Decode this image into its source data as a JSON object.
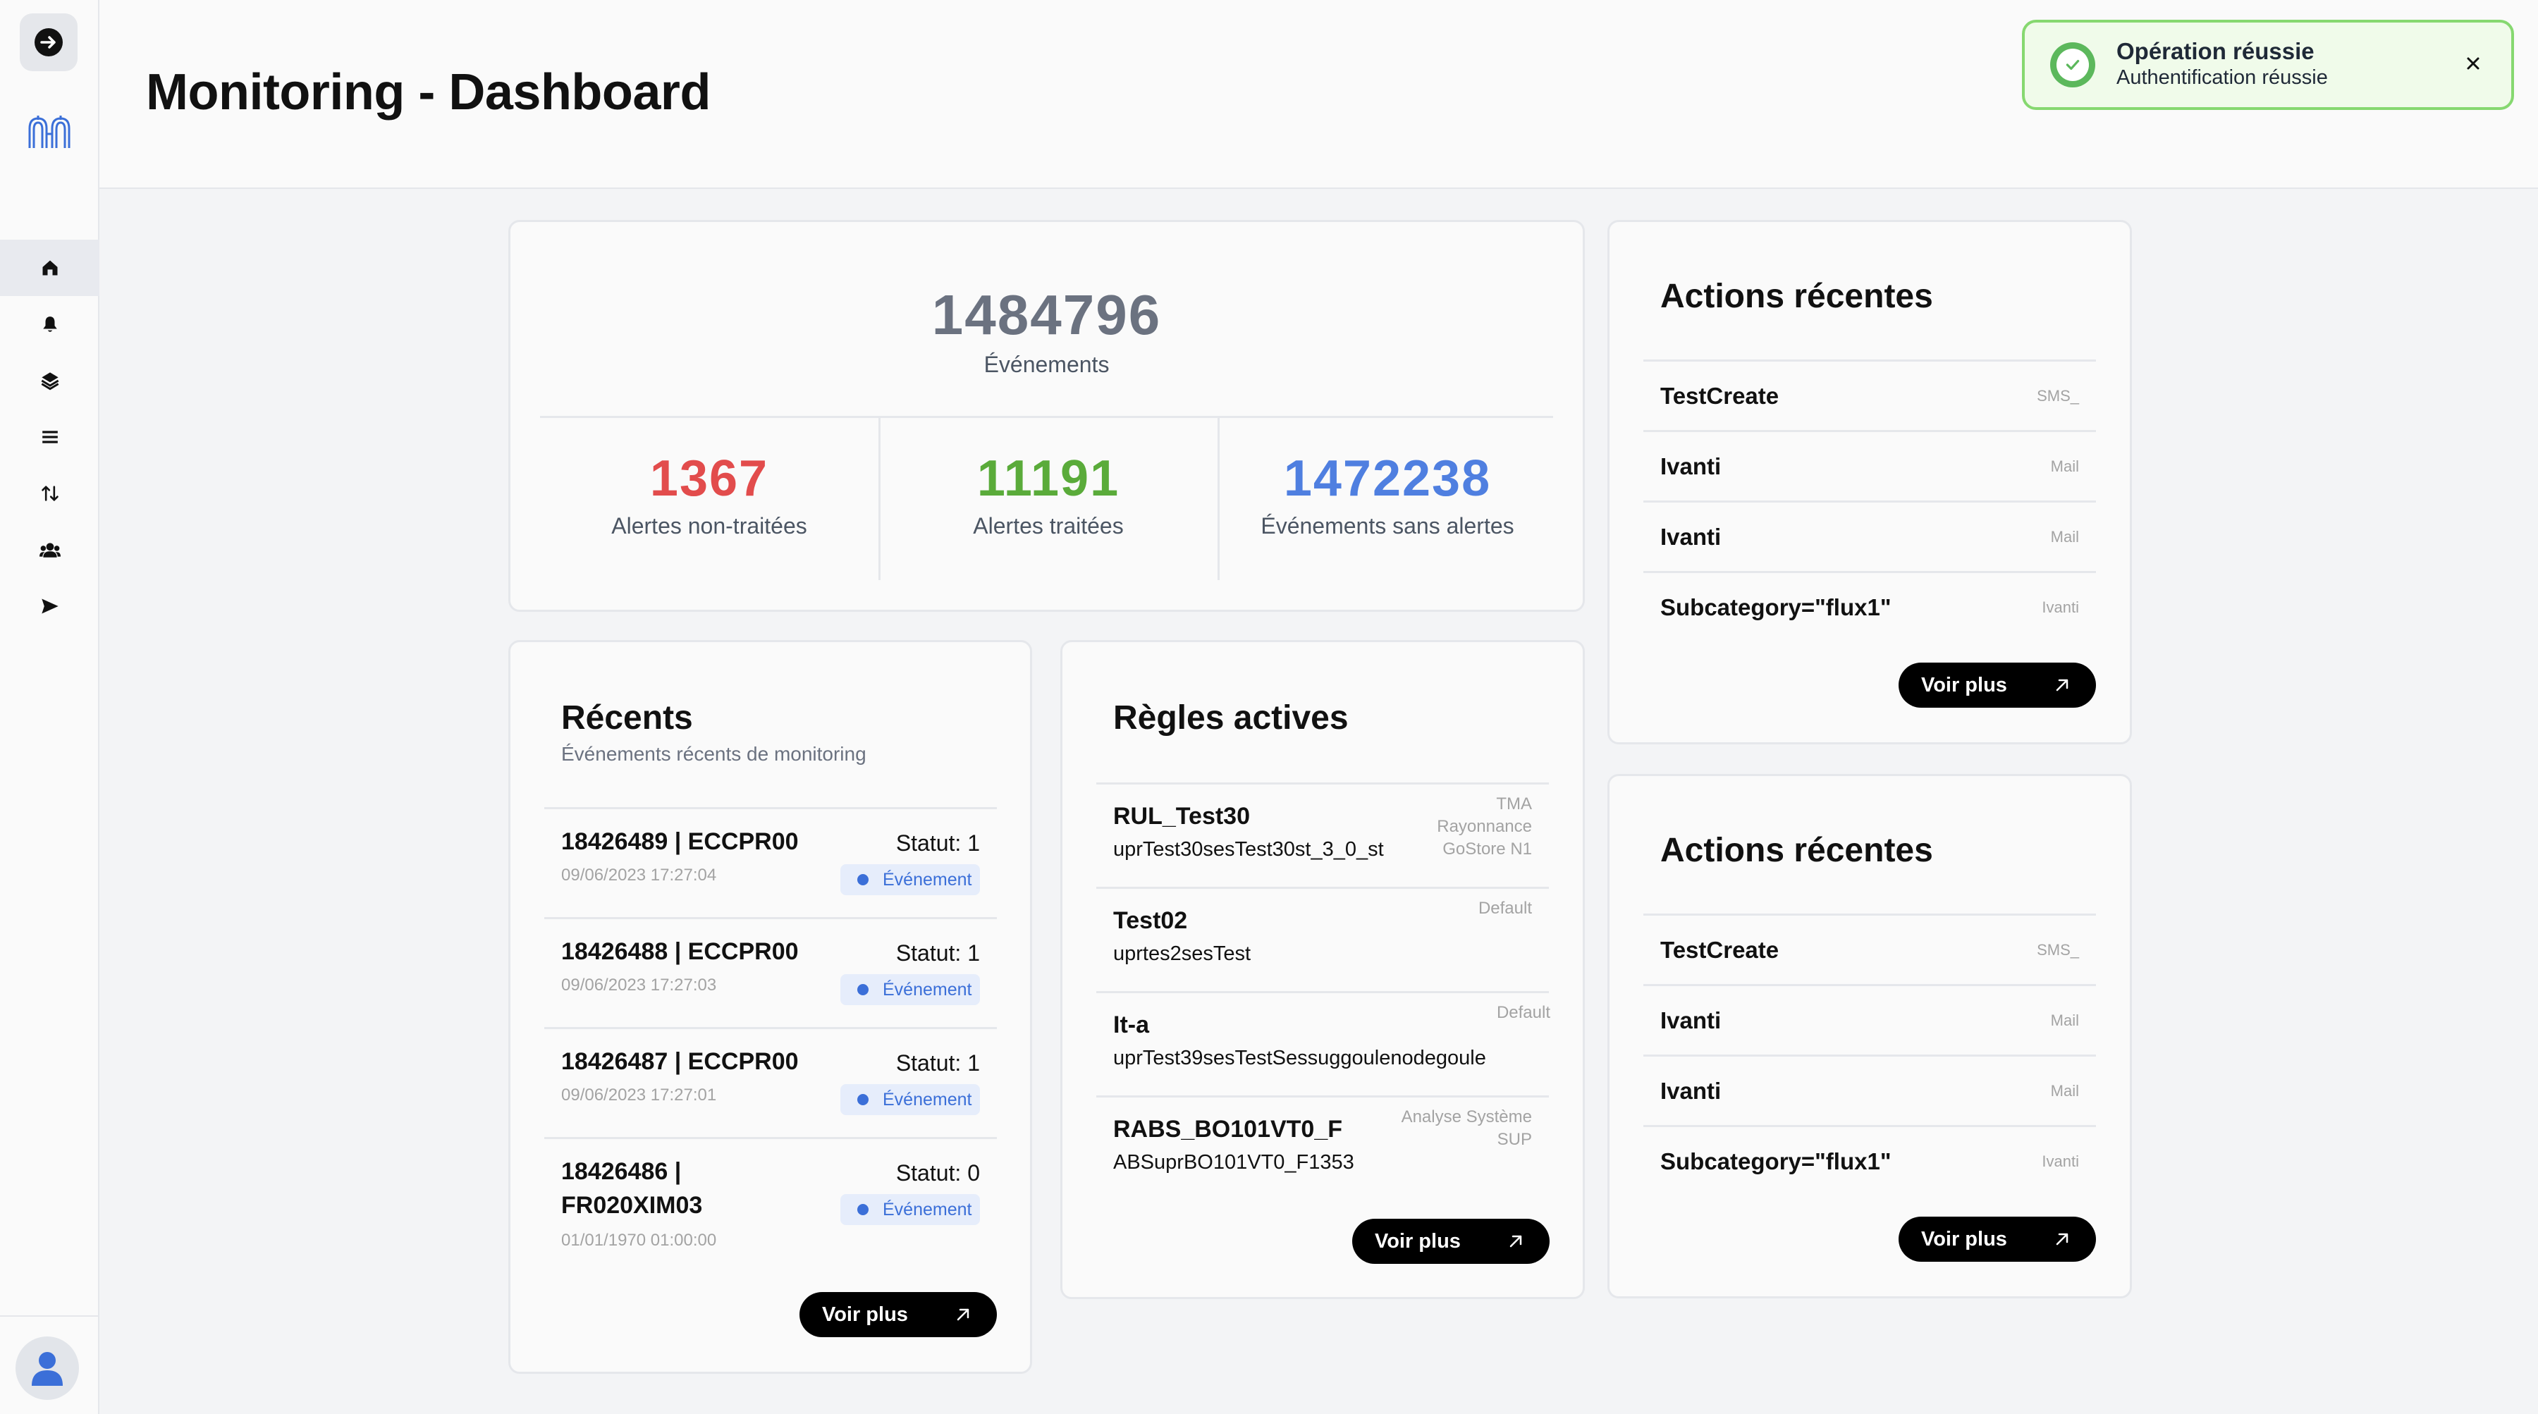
{
  "header": {
    "title": "Monitoring - Dashboard"
  },
  "toast": {
    "title": "Opération réussie",
    "message": "Authentification réussie",
    "status_color": "#5cb85c"
  },
  "sidebar": {
    "items": [
      {
        "icon": "home-icon",
        "active": true
      },
      {
        "icon": "bell-icon"
      },
      {
        "icon": "layers-icon"
      },
      {
        "icon": "list-icon"
      },
      {
        "icon": "arrows-updown-icon"
      },
      {
        "icon": "users-icon"
      },
      {
        "icon": "send-icon"
      }
    ]
  },
  "stats": {
    "total": {
      "value": "1484796",
      "label": "Événements"
    },
    "unprocessed": {
      "value": "1367",
      "label": "Alertes non-traitées",
      "color": "#e24c4c"
    },
    "processed": {
      "value": "11191",
      "label": "Alertes traitées",
      "color": "#5aab3a"
    },
    "no_alerts": {
      "value": "1472238",
      "label": "Événements sans alertes",
      "color": "#4f7fe0"
    }
  },
  "recents": {
    "title": "Récents",
    "subtitle": "Événements récents de monitoring",
    "items": [
      {
        "title": "18426489 | ECCPR00",
        "date": "09/06/2023 17:27:04",
        "status": "Statut: 1",
        "badge": "Événement"
      },
      {
        "title": "18426488 | ECCPR00",
        "date": "09/06/2023 17:27:03",
        "status": "Statut: 1",
        "badge": "Événement"
      },
      {
        "title": "18426487 | ECCPR00",
        "date": "09/06/2023 17:27:01",
        "status": "Statut: 1",
        "badge": "Événement"
      },
      {
        "title_line1": "18426486 |",
        "title_line2": "FR020XIM03",
        "date": "01/01/1970 01:00:00",
        "status": "Statut: 0",
        "badge": "Événement"
      }
    ],
    "button": "Voir plus"
  },
  "rules": {
    "title": "Règles actives",
    "items": [
      {
        "name": "RUL_Test30",
        "desc": "uprTest30sesTest30st_3_0_st",
        "tag_lines": [
          "TMA",
          "Rayonnance",
          "GoStore N1"
        ]
      },
      {
        "name": "Test02",
        "desc": "uprtes2sesTest",
        "tag_lines": [
          "Default"
        ]
      },
      {
        "name": "It-a",
        "desc": "uprTest39sesTestSessuggoulenodegoule",
        "tag_lines": [
          "Default"
        ]
      },
      {
        "name": "RABS_BO101VT0_F",
        "desc": "ABSuprBO101VT0_F1353",
        "tag_lines": [
          "Analyse Système",
          "SUP"
        ]
      }
    ],
    "button": "Voir plus"
  },
  "actions_top": {
    "title": "Actions récentes",
    "items": [
      {
        "name": "TestCreate",
        "tag": "SMS_"
      },
      {
        "name": "Ivanti",
        "tag": "Mail"
      },
      {
        "name": "Ivanti",
        "tag": "Mail"
      },
      {
        "name": "Subcategory=\"flux1\"",
        "tag": "Ivanti"
      }
    ],
    "button": "Voir plus"
  },
  "actions_bottom": {
    "title": "Actions récentes",
    "items": [
      {
        "name": "TestCreate",
        "tag": "SMS_"
      },
      {
        "name": "Ivanti",
        "tag": "Mail"
      },
      {
        "name": "Ivanti",
        "tag": "Mail"
      },
      {
        "name": "Subcategory=\"flux1\"",
        "tag": "Ivanti"
      }
    ],
    "button": "Voir plus"
  }
}
